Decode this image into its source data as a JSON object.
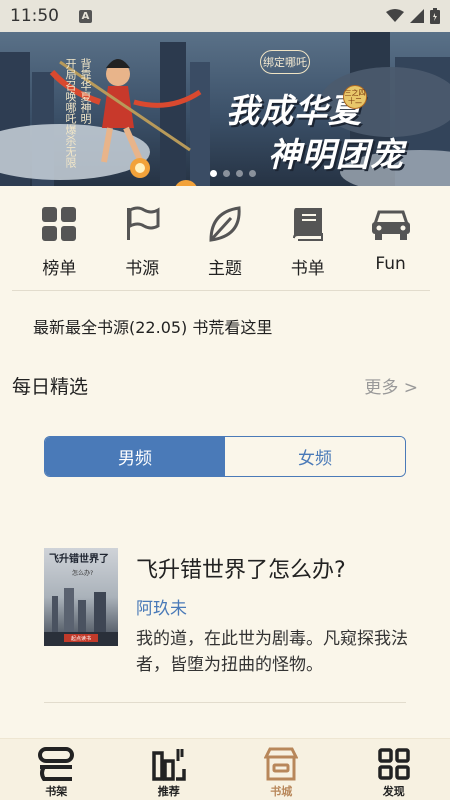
{
  "status": {
    "time": "11:50",
    "a_icon": "A"
  },
  "banner": {
    "seal": "绑定哪吒",
    "vertical_text": [
      "开局召唤哪吒爆杀无限",
      "背靠华夏神明"
    ],
    "title_line1": "我成华夏",
    "title_line2": "神明团宠",
    "badge": "三之四十二",
    "slide_count": 4,
    "active_slide": 0
  },
  "categories": [
    {
      "label": "榜单",
      "icon": "grid-icon"
    },
    {
      "label": "书源",
      "icon": "flag-icon"
    },
    {
      "label": "主题",
      "icon": "leaf-icon"
    },
    {
      "label": "书单",
      "icon": "book-icon"
    },
    {
      "label": "Fun",
      "icon": "car-icon"
    }
  ],
  "notice": "最新最全书源(22.05)   书荒看这里",
  "section": {
    "title": "每日精选",
    "more": "更多 >"
  },
  "tabs": {
    "male": "男频",
    "female": "女频",
    "selected": "男频"
  },
  "book": {
    "title": "飞升错世界了怎么办?",
    "author": "阿玖未",
    "description": "我的道，在此世为剧毒。凡窥探我法者，皆堕为扭曲的怪物。",
    "cover_title": "飞升错世界了",
    "cover_subtitle": "怎么办?",
    "cover_logo": "起点读书"
  },
  "bottom_nav": [
    {
      "label": "书架",
      "icon": "bookshelf-icon"
    },
    {
      "label": "推荐",
      "icon": "recommend-icon"
    },
    {
      "label": "书城",
      "icon": "store-icon"
    },
    {
      "label": "发现",
      "icon": "discover-icon"
    }
  ],
  "active_nav": "书城",
  "colors": {
    "accent": "#4a7ab8",
    "background": "#faf6ea",
    "active_nav": "#b8875a"
  }
}
